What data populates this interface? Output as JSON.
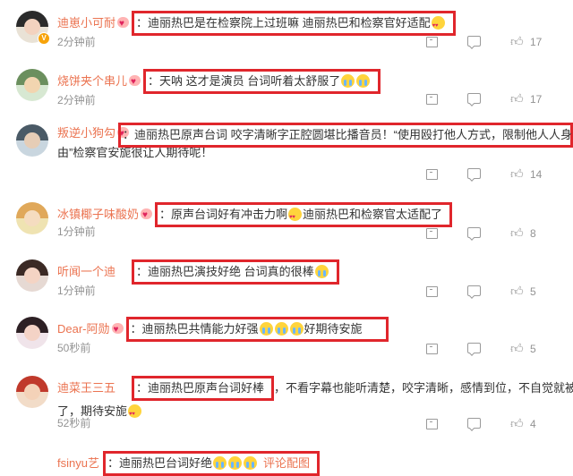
{
  "comments": [
    {
      "username": "迪崽小可耐",
      "text": "：迪丽热巴是在检察院上过班嘛 迪丽热巴和检察官好适配",
      "time": "2分钟前",
      "likes": "17",
      "avatar_colors": [
        "#e9e2d6",
        "#2b2b2b",
        "#f3d2bf"
      ],
      "verified": true
    },
    {
      "username": "烧饼夹个串儿",
      "text": "：天呐 这才是演员 台词听着太舒服了",
      "time": "2分钟前",
      "likes": "17",
      "avatar_colors": [
        "#d7e8d2",
        "#6b8f5e",
        "#f2d5b0"
      ],
      "verified": false
    },
    {
      "username": "叛逆小狗勾",
      "text": "：迪丽热巴原声台词 咬字清晰字正腔圆堪比播音员！“使用殴打他人方式，限制他人人身自",
      "text2": "由”检察官安旎很让人期待呢！",
      "time": "2分钟前",
      "likes": "14",
      "avatar_colors": [
        "#c9d6df",
        "#4a5a66",
        "#e6cdb6"
      ],
      "verified": false
    },
    {
      "username": "冰镇椰子味酸奶",
      "text": "：原声台词好有冲击力啊",
      "text_b": "迪丽热巴和检察官太适配了",
      "time": "1分钟前",
      "likes": "8",
      "avatar_colors": [
        "#efe3b2",
        "#e0a85a",
        "#f5dcc0"
      ],
      "verified": false
    },
    {
      "username": "听闻一个迪",
      "text": "：迪丽热巴演技好绝 台词真的很棒",
      "time": "1分钟前",
      "likes": "5",
      "avatar_colors": [
        "#e6d9d3",
        "#3b2a25",
        "#f4d4c4"
      ],
      "verified": false
    },
    {
      "username": "Dear-阿勋",
      "text": "：迪丽热巴共情能力好强",
      "text_b": "好期待安旎",
      "time": "50秒前",
      "likes": "5",
      "avatar_colors": [
        "#f0e4ea",
        "#2d2024",
        "#f4d3c6"
      ],
      "verified": false
    },
    {
      "username": "迪菜王三五",
      "text": "：迪丽热巴原声台词好棒",
      "text_tail": "，不看字幕也能听清楚，咬字清晰，感情到位，不自觉就被带入",
      "text2": "了，期待安旎",
      "time": "52秒前",
      "likes": "4",
      "avatar_colors": [
        "#f2dcc8",
        "#c0392b",
        "#f4d2b8"
      ],
      "verified": false
    },
    {
      "username": "fsinyu艺",
      "text": "：迪丽热巴台词好绝",
      "text_tail": "评论配图",
      "verified": false
    }
  ],
  "accent_color": "#eb7350",
  "highlight_color": "#e0262c"
}
